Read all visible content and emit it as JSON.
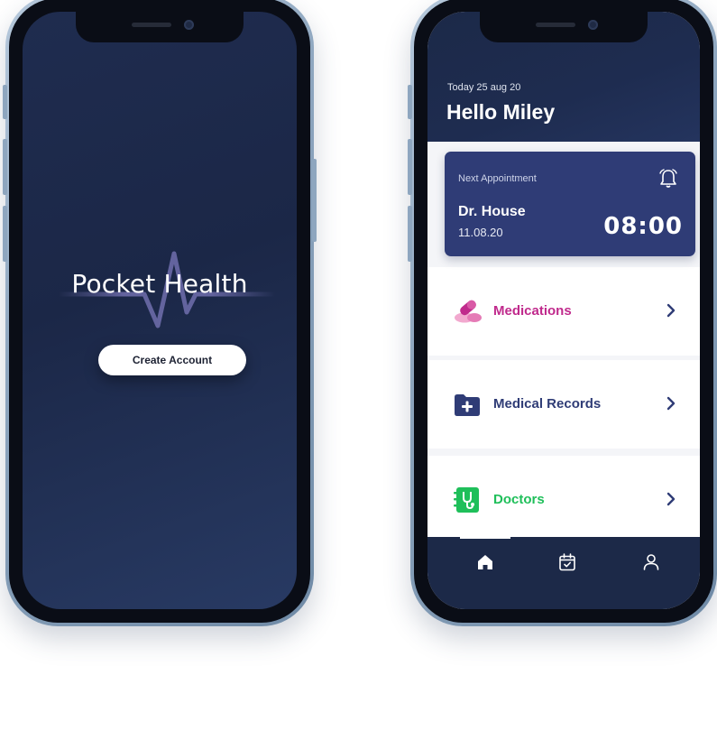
{
  "welcome_screen": {
    "app_title": "Pocket Health",
    "create_account_label": "Create Account"
  },
  "home_screen": {
    "date_line": "Today 25 aug 20",
    "greeting": "Hello Miley",
    "appointment": {
      "label": "Next Appointment",
      "doctor": "Dr. House",
      "date": "11.08.20",
      "time": "08:00",
      "icon": "alarm-bell-icon"
    },
    "menu": [
      {
        "label": "Medications",
        "icon": "pills-icon",
        "color": "#c02a8c"
      },
      {
        "label": "Medical Records",
        "icon": "folder-plus-icon",
        "color": "#2f3c76"
      },
      {
        "label": "Doctors",
        "icon": "stethoscope-notebook-icon",
        "color": "#1fbf5a"
      }
    ],
    "bottom_nav": [
      {
        "icon": "home-icon",
        "active": true
      },
      {
        "icon": "calendar-check-icon",
        "active": false
      },
      {
        "icon": "user-icon",
        "active": false
      }
    ]
  },
  "colors": {
    "navy": "#1c2948",
    "card": "#2f3c76",
    "medications": "#c02a8c",
    "records": "#2f3c76",
    "doctors": "#1fbf5a"
  }
}
